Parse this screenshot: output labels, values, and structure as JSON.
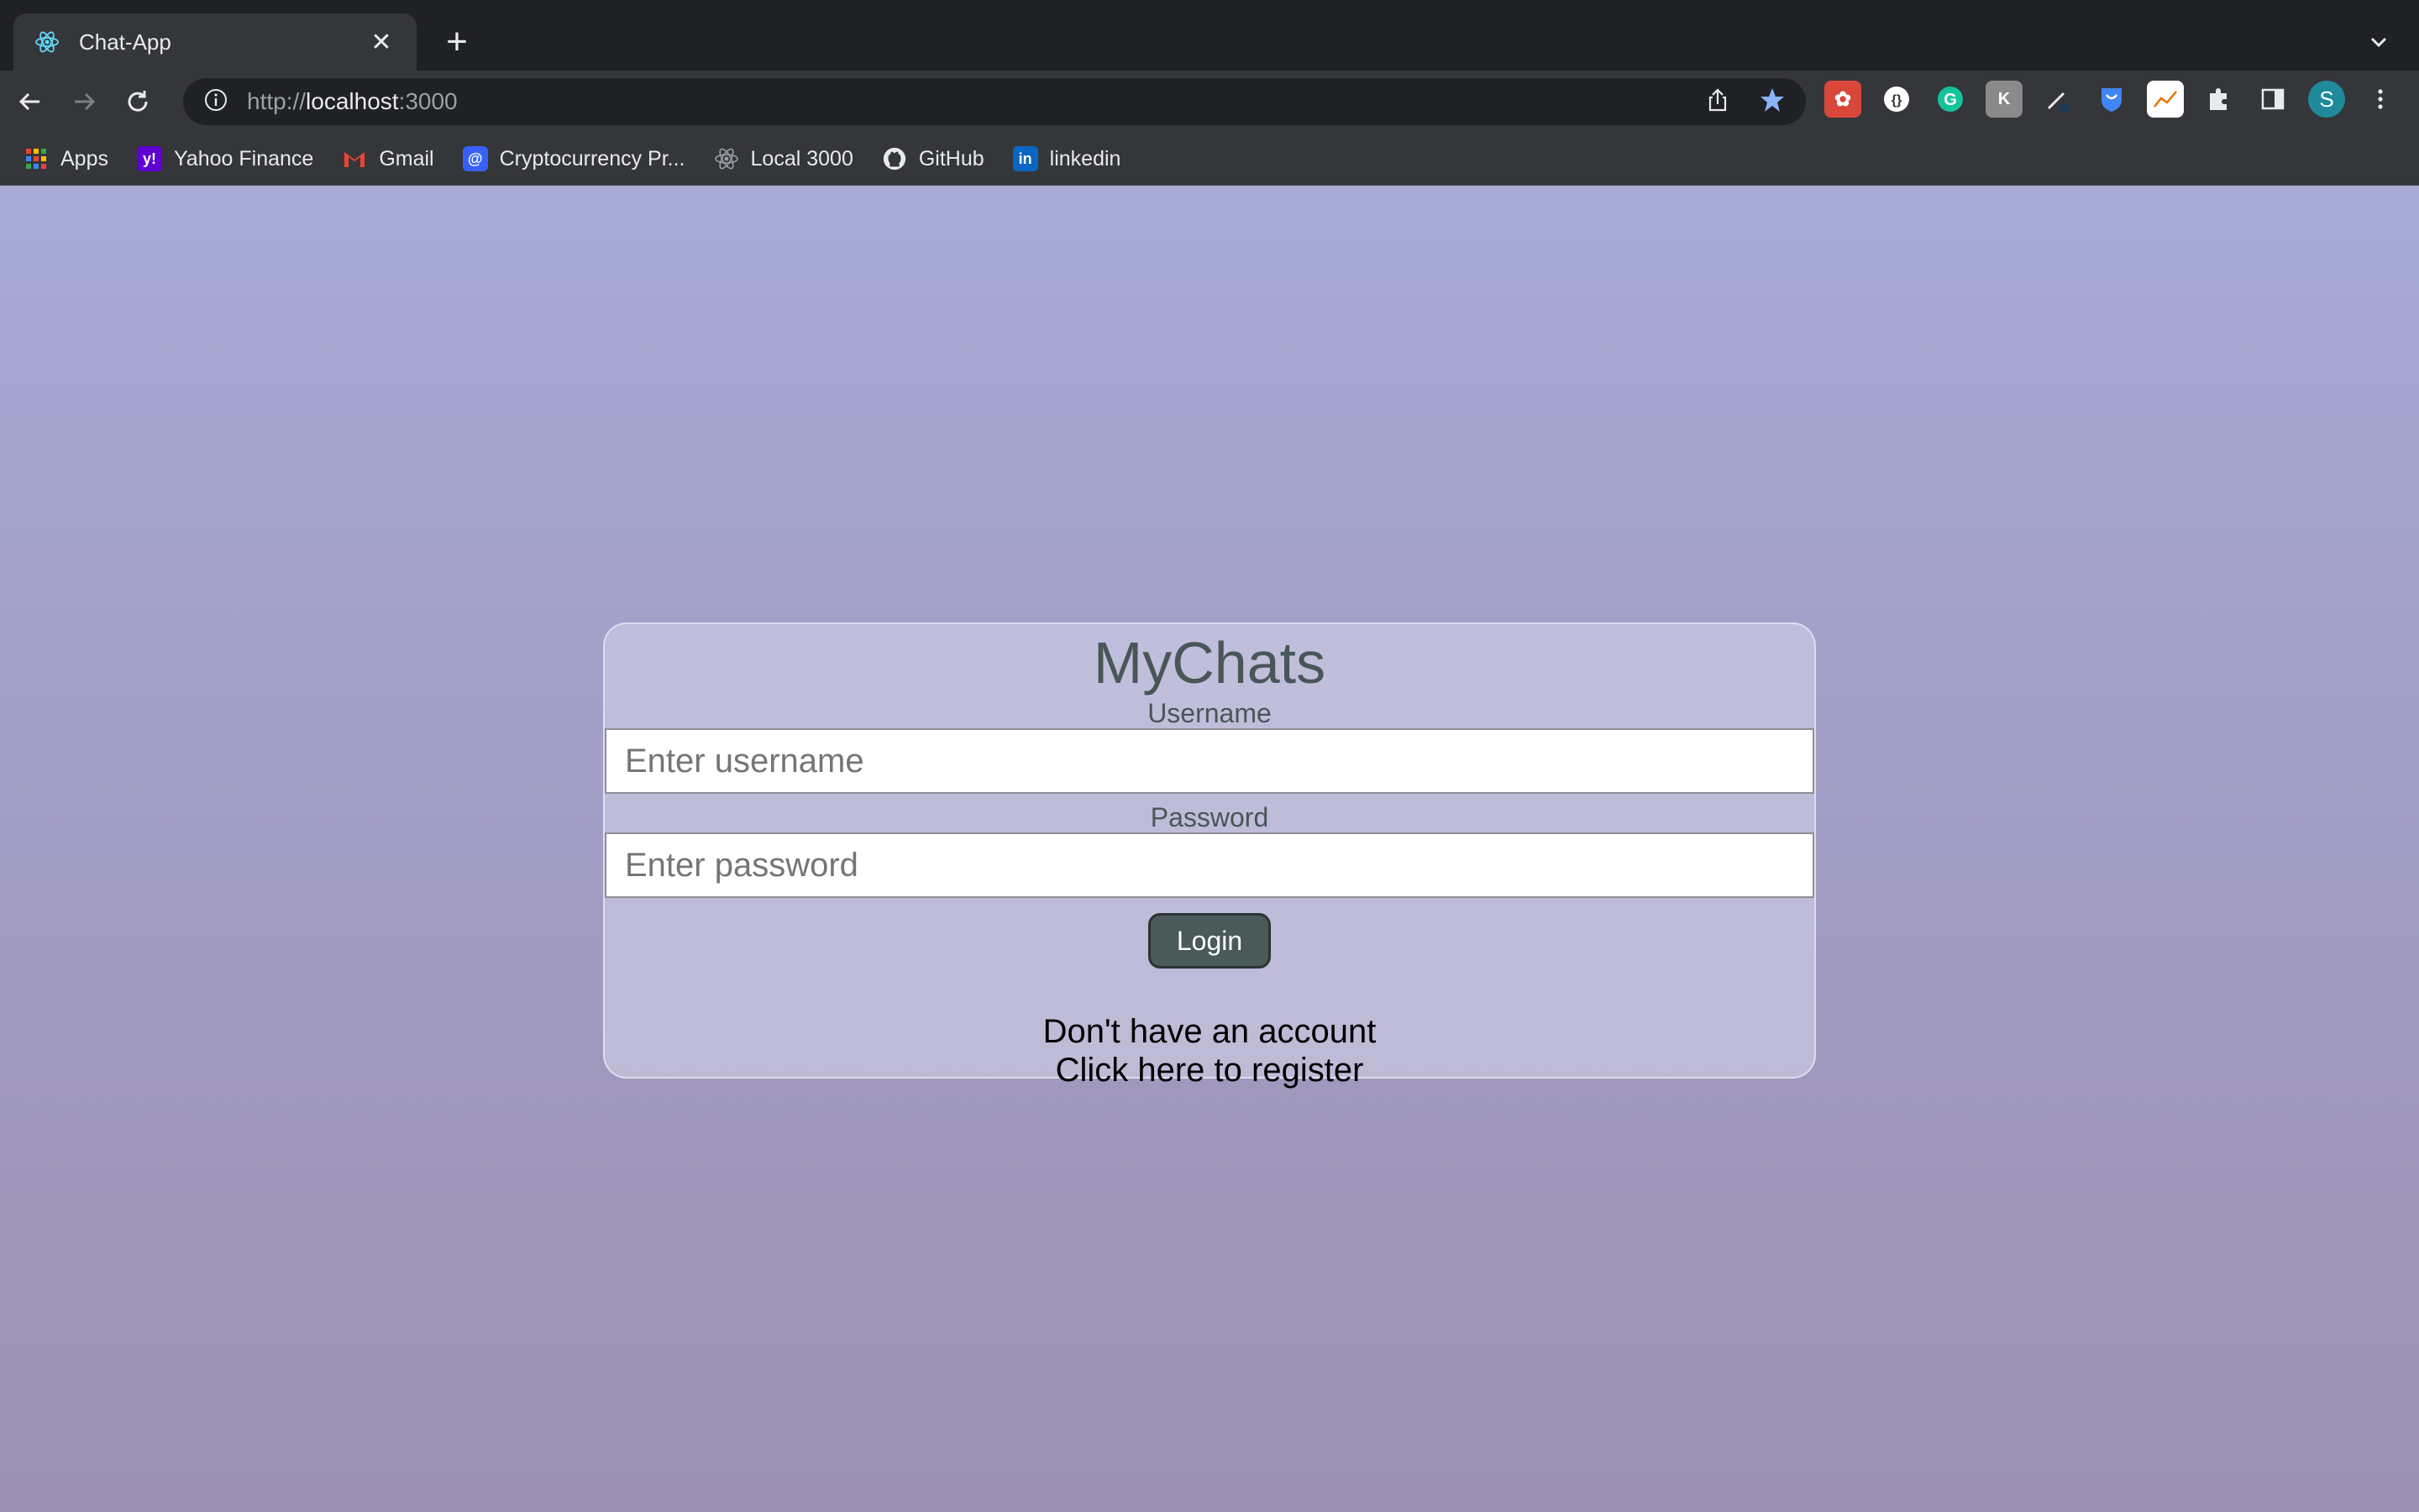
{
  "browser": {
    "tab": {
      "title": "Chat-App"
    },
    "url": {
      "scheme": "http://",
      "host": "localhost",
      "port": ":3000"
    },
    "bookmarks": [
      {
        "label": "Apps",
        "icon": "apps-grid-icon"
      },
      {
        "label": "Yahoo Finance",
        "icon": "yahoo-icon",
        "color": "#6001d2",
        "glyph": "y!"
      },
      {
        "label": "Gmail",
        "icon": "gmail-icon",
        "color": "#ea4335",
        "glyph": "M"
      },
      {
        "label": "Cryptocurrency Pr...",
        "icon": "coinmarketcap-icon",
        "color": "#3861fb",
        "glyph": "@"
      },
      {
        "label": "Local 3000",
        "icon": "react-icon"
      },
      {
        "label": "GitHub",
        "icon": "github-icon"
      },
      {
        "label": "linkedin",
        "icon": "linkedin-icon",
        "color": "#0a66c2",
        "glyph": "in"
      }
    ],
    "profile_initial": "S"
  },
  "app": {
    "title": "MyChats",
    "username_label": "Username",
    "username_placeholder": "Enter username",
    "password_label": "Password",
    "password_placeholder": "Enter password",
    "login_label": "Login",
    "register_line1": "Don't have an account",
    "register_line2": "Click here to register"
  },
  "colors": {
    "accent_text": "#485657",
    "button": "#4a5a59",
    "background_top": "#a7abd5",
    "background_bottom": "#9d92b3"
  }
}
